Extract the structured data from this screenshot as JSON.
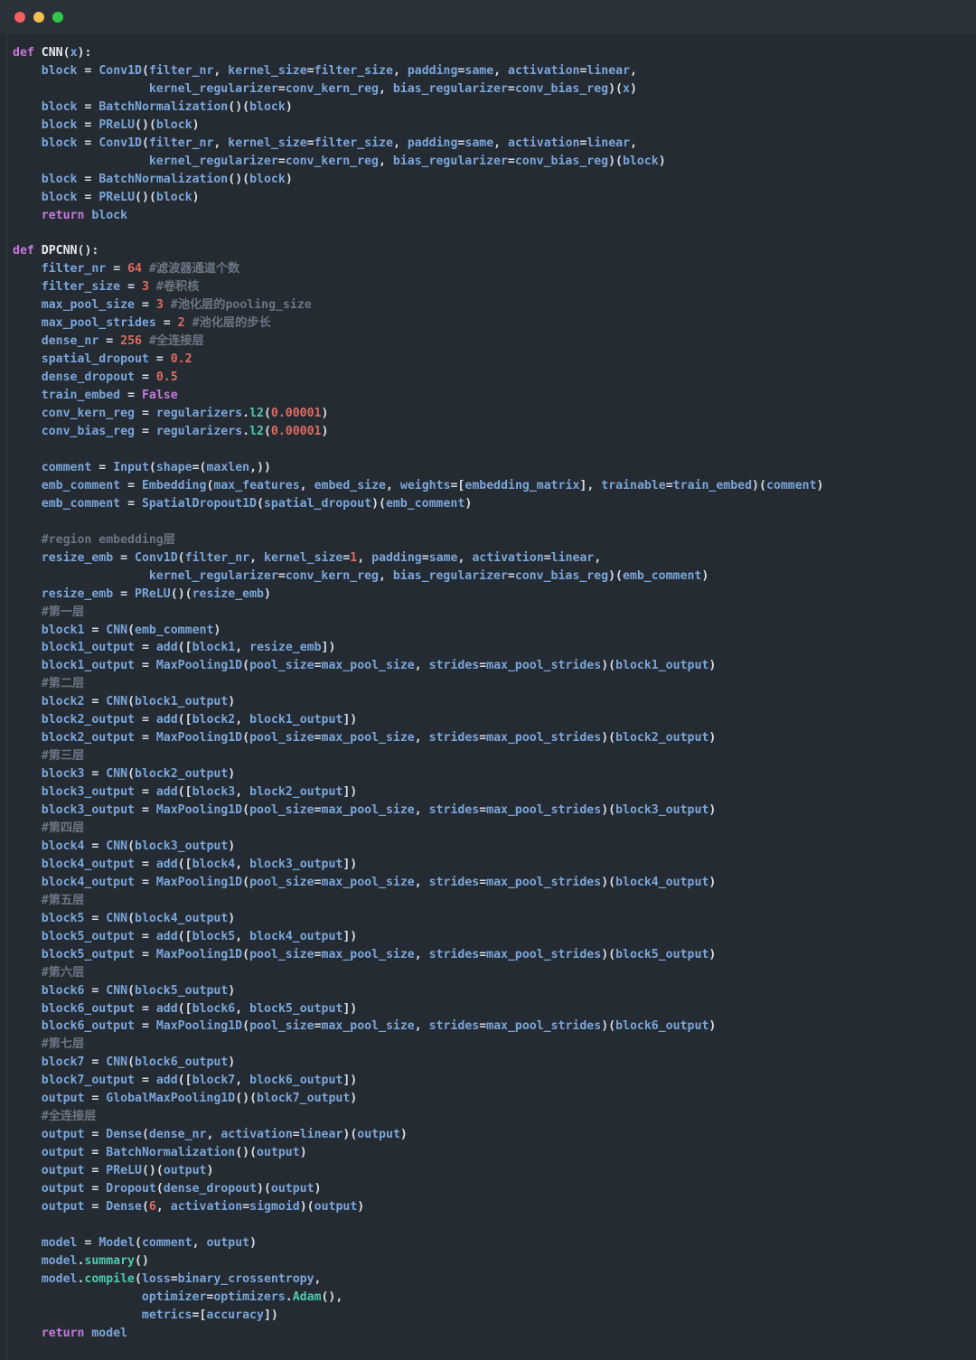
{
  "window": {
    "title": "",
    "traffic_lights": [
      {
        "name": "close",
        "color": "#f2615e"
      },
      {
        "name": "minimize",
        "color": "#f5bd4f"
      },
      {
        "name": "zoom",
        "color": "#32c847"
      }
    ],
    "background": "#252b33",
    "titlebar_background": "#2b3139"
  },
  "theme": {
    "keyword": "#c678dd",
    "function_name": "#e6eaf0",
    "identifier": "#7aa6da",
    "number": "#e06c60",
    "comment": "#6b7684",
    "method": "#4ec9b0",
    "punctuation": "#d8dee9",
    "background": "#252b33"
  },
  "editor": {
    "language": "python",
    "code": "def CNN(x):\n    block = Conv1D(filter_nr, kernel_size=filter_size, padding=same, activation=linear,\n                   kernel_regularizer=conv_kern_reg, bias_regularizer=conv_bias_reg)(x)\n    block = BatchNormalization()(block)\n    block = PReLU()(block)\n    block = Conv1D(filter_nr, kernel_size=filter_size, padding=same, activation=linear,\n                   kernel_regularizer=conv_kern_reg, bias_regularizer=conv_bias_reg)(block)\n    block = BatchNormalization()(block)\n    block = PReLU()(block)\n    return block\n\ndef DPCNN():\n    filter_nr = 64 #滤波器通道个数\n    filter_size = 3 #卷积核\n    max_pool_size = 3 #池化层的pooling_size\n    max_pool_strides = 2 #池化层的步长\n    dense_nr = 256 #全连接层\n    spatial_dropout = 0.2\n    dense_dropout = 0.5\n    train_embed = False\n    conv_kern_reg = regularizers.l2(0.00001)\n    conv_bias_reg = regularizers.l2(0.00001)\n\n    comment = Input(shape=(maxlen,))\n    emb_comment = Embedding(max_features, embed_size, weights=[embedding_matrix], trainable=train_embed)(comment)\n    emb_comment = SpatialDropout1D(spatial_dropout)(emb_comment)\n\n    #region embedding层\n    resize_emb = Conv1D(filter_nr, kernel_size=1, padding=same, activation=linear,\n                   kernel_regularizer=conv_kern_reg, bias_regularizer=conv_bias_reg)(emb_comment)\n    resize_emb = PReLU()(resize_emb)\n    #第一层\n    block1 = CNN(emb_comment)\n    block1_output = add([block1, resize_emb])\n    block1_output = MaxPooling1D(pool_size=max_pool_size, strides=max_pool_strides)(block1_output)\n    #第二层\n    block2 = CNN(block1_output)\n    block2_output = add([block2, block1_output])\n    block2_output = MaxPooling1D(pool_size=max_pool_size, strides=max_pool_strides)(block2_output)\n    #第三层\n    block3 = CNN(block2_output)\n    block3_output = add([block3, block2_output])\n    block3_output = MaxPooling1D(pool_size=max_pool_size, strides=max_pool_strides)(block3_output)\n    #第四层\n    block4 = CNN(block3_output)\n    block4_output = add([block4, block3_output])\n    block4_output = MaxPooling1D(pool_size=max_pool_size, strides=max_pool_strides)(block4_output)\n    #第五层\n    block5 = CNN(block4_output)\n    block5_output = add([block5, block4_output])\n    block5_output = MaxPooling1D(pool_size=max_pool_size, strides=max_pool_strides)(block5_output)\n    #第六层\n    block6 = CNN(block5_output)\n    block6_output = add([block6, block5_output])\n    block6_output = MaxPooling1D(pool_size=max_pool_size, strides=max_pool_strides)(block6_output)\n    #第七层\n    block7 = CNN(block6_output)\n    block7_output = add([block7, block6_output])\n    output = GlobalMaxPooling1D()(block7_output)\n    #全连接层\n    output = Dense(dense_nr, activation=linear)(output)\n    output = BatchNormalization()(output)\n    output = PReLU()(output)\n    output = Dropout(dense_dropout)(output)\n    output = Dense(6, activation=sigmoid)(output)\n\n    model = Model(comment, output)\n    model.summary()\n    model.compile(loss=binary_crossentropy,\n                  optimizer=optimizers.Adam(),\n                  metrics=[accuracy])\n    return model"
  }
}
